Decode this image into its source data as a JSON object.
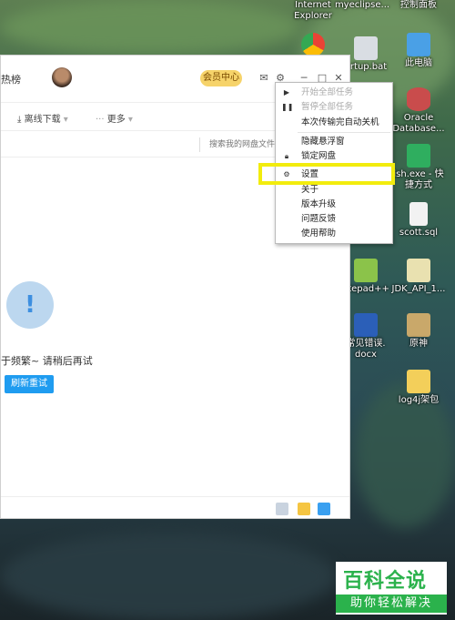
{
  "desktop": {
    "icons": [
      {
        "label": "Internet\nExplorer"
      },
      {
        "label": "myeclipse..."
      },
      {
        "label": "控制面板"
      },
      {
        "label": "artup.bat"
      },
      {
        "label": "此电脑"
      },
      {
        "label": "Oracle\nDatabase..."
      },
      {
        "label": "ish.exe - 快\n捷方式"
      },
      {
        "label": "scott.sql"
      },
      {
        "label": "otepad++"
      },
      {
        "label": "JDK_API_1..."
      },
      {
        "label": "常见错误.\ndocx"
      },
      {
        "label": "原神"
      },
      {
        "label": "log4j架包"
      }
    ]
  },
  "app": {
    "hotlist_label": "热榜",
    "vip_label": "会员中心",
    "toolbar": {
      "offline_download": "离线下载",
      "more": "更多"
    },
    "search_placeholder": "搜索我的网盘文件",
    "error_message": "于频繁~ 请稍后再试",
    "retry_label": "刷新重试",
    "alert_glyph": "!"
  },
  "menu": {
    "items": [
      {
        "label": "开始全部任务",
        "disabled": true,
        "icon": "play-icon"
      },
      {
        "label": "暂停全部任务",
        "disabled": true,
        "icon": "pause-icon"
      },
      {
        "label": "本次传输完自动关机",
        "disabled": false
      },
      {
        "label": "隐藏悬浮窗",
        "disabled": false
      },
      {
        "label": "锁定网盘",
        "disabled": false,
        "icon": "lock-icon"
      },
      {
        "label": "设置",
        "disabled": false,
        "icon": "gear-icon",
        "highlighted": true
      },
      {
        "label": "关于",
        "disabled": false
      },
      {
        "label": "版本升级",
        "disabled": false
      },
      {
        "label": "问题反馈",
        "disabled": false
      },
      {
        "label": "使用帮助",
        "disabled": false
      }
    ]
  },
  "watermark": {
    "title": "百科全说",
    "subtitle": "助你轻松解决"
  },
  "colors": {
    "vip": "#f6d36a",
    "retry": "#1f9cf0",
    "highlight": "#f2ec0d",
    "watermark_green": "#2bb24c"
  }
}
